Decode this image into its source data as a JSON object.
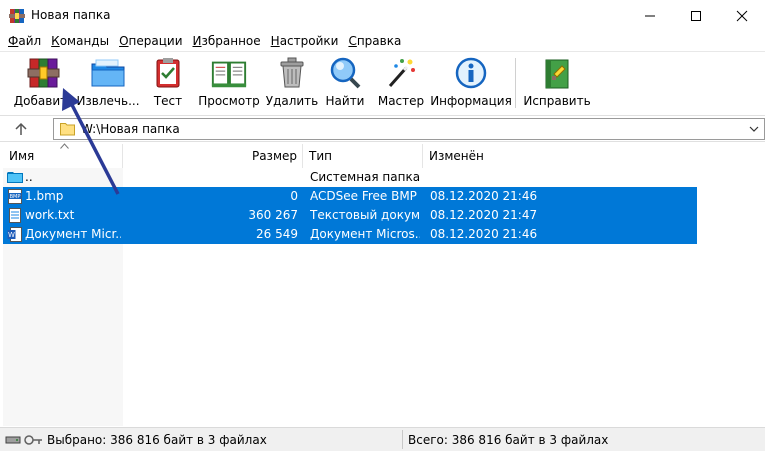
{
  "window": {
    "title": "Новая папка"
  },
  "menu": {
    "items": [
      {
        "first": "Ф",
        "rest": "айл"
      },
      {
        "first": "К",
        "rest": "оманды"
      },
      {
        "first": "О",
        "rest": "перации"
      },
      {
        "first": "И",
        "rest": "збранное"
      },
      {
        "first": "Н",
        "rest": "астройки"
      },
      {
        "first": "С",
        "rest": "правка"
      }
    ]
  },
  "toolbar": {
    "add": "Добавить",
    "extract": "Извлечь...",
    "test": "Тест",
    "view": "Просмотр",
    "delete": "Удалить",
    "find": "Найти",
    "wizard": "Мастер",
    "info": "Информация",
    "repair": "Исправить"
  },
  "address": {
    "path": "W:\\Новая папка"
  },
  "columns": {
    "name": "Имя",
    "size": "Размер",
    "type": "Тип",
    "modified": "Изменён"
  },
  "rows": [
    {
      "name": "..",
      "size": "",
      "type": "Системная папка",
      "modified": "",
      "selected": false,
      "icon": "parent-folder-icon"
    },
    {
      "name": "1.bmp",
      "size": "0",
      "type": "ACDSee Free BMP ...",
      "modified": "08.12.2020 21:46",
      "selected": true,
      "icon": "bmp-file-icon"
    },
    {
      "name": "work.txt",
      "size": "360 267",
      "type": "Текстовый докум...",
      "modified": "08.12.2020 21:47",
      "selected": true,
      "icon": "text-file-icon"
    },
    {
      "name": "Документ Micr...",
      "size": "26 549",
      "type": "Документ Micros...",
      "modified": "08.12.2020 21:46",
      "selected": true,
      "icon": "word-doc-icon"
    }
  ],
  "status": {
    "selected": "Выбрано: 386 816 байт в 3 файлах",
    "total": "Всего: 386 816 байт в 3 файлах"
  },
  "colors": {
    "selection": "#0078d7",
    "annotation_arrow": "#2b3a96"
  }
}
